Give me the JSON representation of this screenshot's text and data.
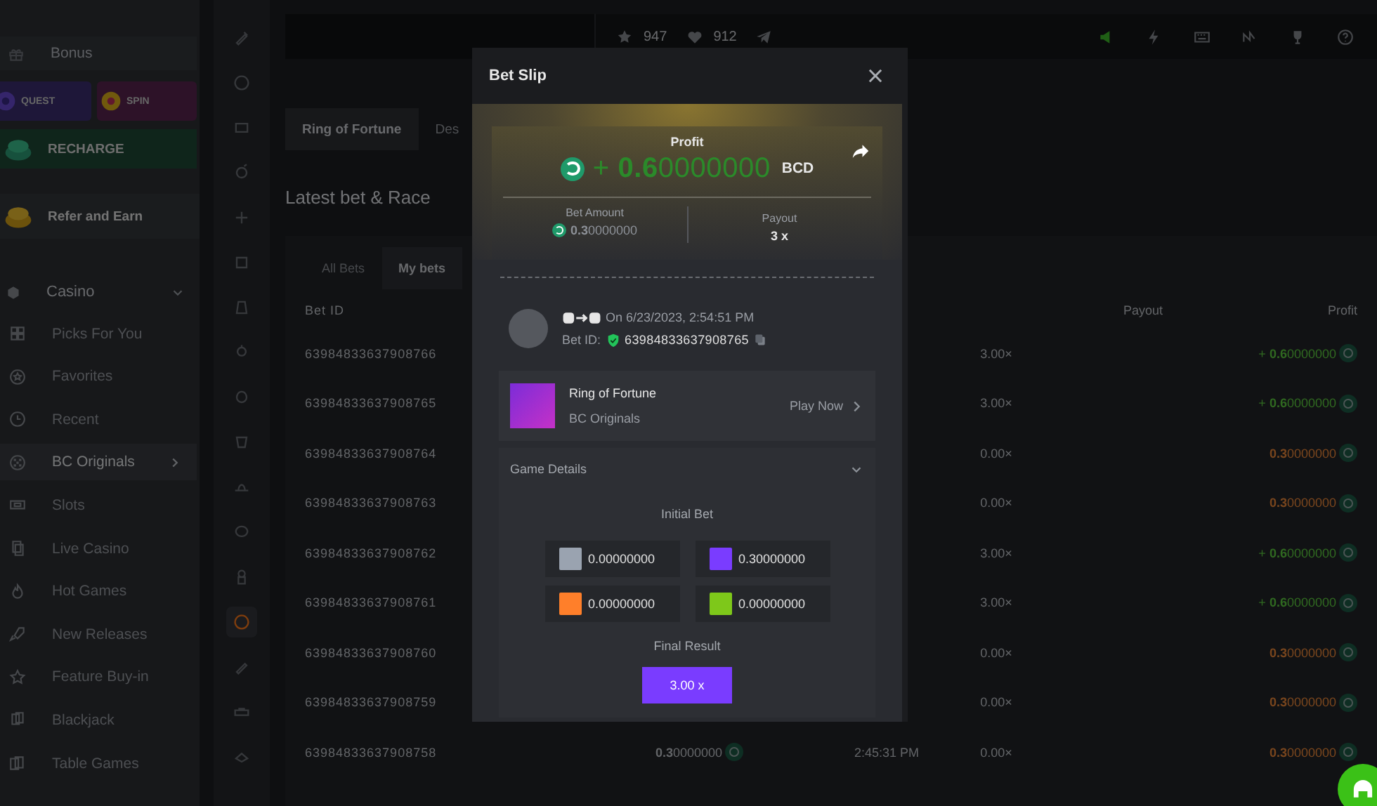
{
  "sidebar": {
    "items": [
      {
        "kind": "plain",
        "label": "Bonus"
      },
      {
        "kind": "tiles",
        "tiles": [
          "QUEST",
          "SPIN"
        ]
      },
      {
        "kind": "promo",
        "label": "RECHARGE"
      },
      {
        "kind": "promo",
        "label": "Refer and Earn"
      },
      {
        "kind": "group",
        "label": "Casino",
        "expanded": true
      },
      {
        "kind": "nav",
        "label": "Picks For You",
        "selected": false
      },
      {
        "kind": "nav",
        "label": "Favorites",
        "selected": false
      },
      {
        "kind": "nav",
        "label": "Recent",
        "selected": false
      },
      {
        "kind": "nav",
        "label": "BC Originals",
        "selected": true
      },
      {
        "kind": "nav",
        "label": "Slots",
        "selected": false
      },
      {
        "kind": "nav",
        "label": "Live Casino",
        "selected": false
      },
      {
        "kind": "nav",
        "label": "Hot Games",
        "selected": false
      },
      {
        "kind": "nav",
        "label": "New Releases",
        "selected": false
      },
      {
        "kind": "nav",
        "label": "Feature Buy-in",
        "selected": false
      },
      {
        "kind": "nav",
        "label": "Blackjack",
        "selected": false
      },
      {
        "kind": "nav",
        "label": "Table Games",
        "selected": false
      }
    ]
  },
  "rail": {
    "items": [
      {
        "selected": false
      },
      {
        "selected": false
      },
      {
        "selected": false
      },
      {
        "selected": false
      },
      {
        "selected": false
      },
      {
        "selected": false
      },
      {
        "selected": false
      },
      {
        "selected": false
      },
      {
        "selected": false
      },
      {
        "selected": false
      },
      {
        "selected": false
      },
      {
        "selected": false
      },
      {
        "selected": false
      },
      {
        "selected": true
      },
      {
        "selected": false
      },
      {
        "selected": false
      },
      {
        "selected": false
      }
    ]
  },
  "topbar": {
    "stars": "947",
    "likes": "912"
  },
  "game_tabs": [
    {
      "label": "Ring of Fortune",
      "selected": true
    },
    {
      "label": "Des",
      "selected": false
    }
  ],
  "heading": "Latest bet & Race",
  "bet_tabs": [
    {
      "label": "All Bets",
      "selected": false
    },
    {
      "label": "My bets",
      "selected": true
    }
  ],
  "table": {
    "columns": {
      "id": "Bet ID",
      "payout": "Payout",
      "profit": "Profit"
    },
    "rows": [
      {
        "id": "63984833637908766",
        "payout": "3.00×",
        "profit": "+ **0.6**0000000",
        "win": true
      },
      {
        "id": "63984833637908765",
        "payout": "3.00×",
        "profit": "+ **0.6**0000000",
        "win": true
      },
      {
        "id": "63984833637908764",
        "payout": "0.00×",
        "profit": "**0.3**0000000",
        "win": false
      },
      {
        "id": "63984833637908763",
        "payout": "0.00×",
        "profit": "**0.3**0000000",
        "win": false
      },
      {
        "id": "63984833637908762",
        "payout": "3.00×",
        "profit": "+ **0.6**0000000",
        "win": true
      },
      {
        "id": "63984833637908761",
        "payout": "3.00×",
        "profit": "+ **0.6**0000000",
        "win": true
      },
      {
        "id": "63984833637908760",
        "payout": "0.00×",
        "profit": "**0.3**0000000",
        "win": false
      },
      {
        "id": "63984833637908759",
        "payout": "0.00×",
        "profit": "**0.3**0000000",
        "win": false
      },
      {
        "id": "63984833637908758",
        "amount": "**0.3**0000000",
        "time": "2:45:31 PM",
        "payout": "0.00×",
        "profit": "**0.3**0000000",
        "win": false
      }
    ]
  },
  "modal": {
    "title": "Bet Slip",
    "profit_label": "Profit",
    "profit": "+ **0.6**0000000",
    "currency": "BCD",
    "bet_amount_label": "Bet Amount",
    "bet_amount": "**0.3**0000000",
    "payout_label": "Payout",
    "payout": "3 x",
    "date": "On 6/23/2023, 2:54:51 PM",
    "bet_id_label": "Bet ID:",
    "bet_id": "63984833637908765",
    "game": {
      "name": "Ring of Fortune",
      "provider": "BC Originals",
      "action": "Play Now"
    },
    "details": {
      "title": "Game Details",
      "expanded": true,
      "initial_bet_label": "Initial Bet",
      "bets": [
        {
          "color": "#9aa3b0",
          "value": "0.00000000"
        },
        {
          "color": "#7a3cff",
          "value": "0.30000000"
        },
        {
          "color": "#ff7f2a",
          "value": "0.00000000"
        },
        {
          "color": "#7ec81a",
          "value": "0.00000000"
        }
      ],
      "final_result_label": "Final Result",
      "final_result": "3.00 x"
    }
  }
}
